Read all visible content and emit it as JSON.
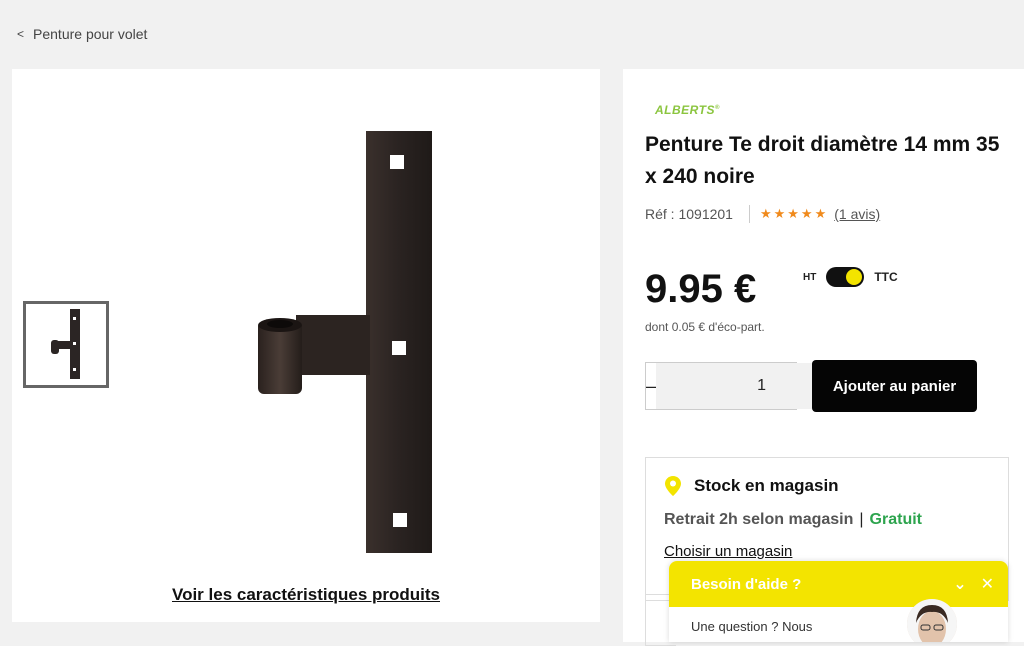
{
  "breadcrumb": {
    "label": "Penture pour volet"
  },
  "gallery": {
    "see_specs": "Voir les caractéristiques produits"
  },
  "product": {
    "brand": "ALBERTS",
    "title": "Penture Te droit diamètre 14 mm 35 x 240 noire",
    "ref": "Réf : 1091201",
    "stars": "★★★★★",
    "rating": 5,
    "reviews": "(1 avis)",
    "price": "9.95 €",
    "eco": "dont 0.05 € d'éco-part.",
    "tax_ht": "HT",
    "tax_ttc": "TTC"
  },
  "cart": {
    "minus": "–",
    "plus": "+",
    "quantity": "1",
    "add_label": "Ajouter au panier"
  },
  "stock": {
    "title": "Stock en magasin",
    "pickup": "Retrait 2h selon magasin",
    "separator": "|",
    "free": "Gratuit",
    "choose": "Choisir un magasin"
  },
  "help": {
    "title": "Besoin d'aide ?",
    "body": "Une question ? Nous"
  },
  "colors": {
    "accent_yellow": "#f3e400",
    "brand_green": "#8bc53f",
    "star_orange": "#f08a1c",
    "free_green": "#2da44e"
  }
}
